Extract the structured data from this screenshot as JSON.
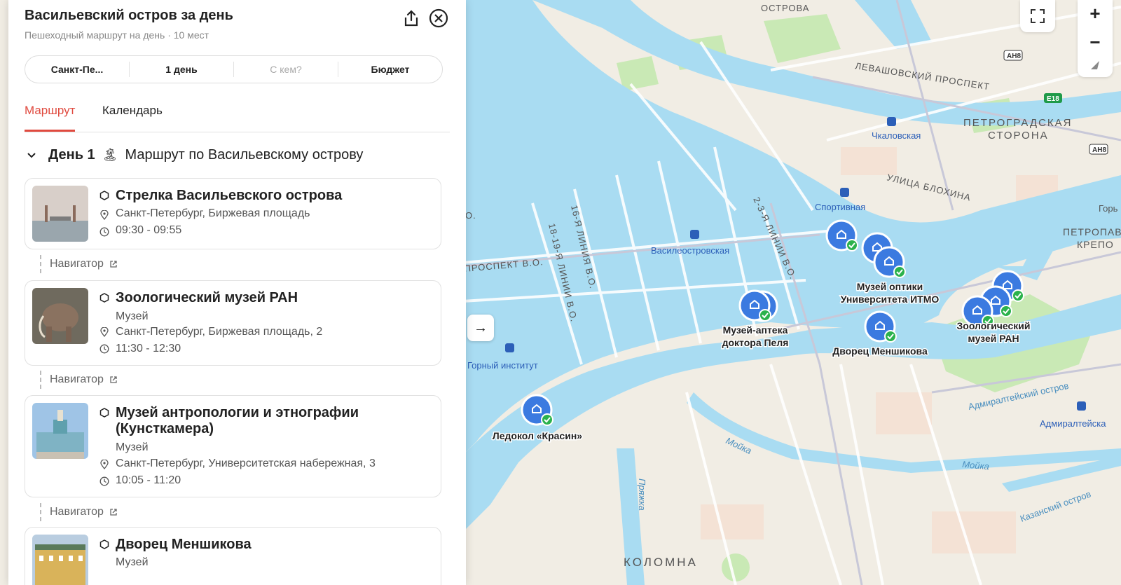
{
  "header": {
    "title": "Васильевский остров за день",
    "subtitle": "Пешеходный маршрут на день · 10 мест"
  },
  "filters": {
    "city": "Санкт-Пе...",
    "days": "1 день",
    "company": "С кем?",
    "budget": "Бюджет"
  },
  "tabs": {
    "route": "Маршрут",
    "calendar": "Календарь"
  },
  "day": {
    "label": "День 1",
    "emoji": "🏝",
    "title": "Маршрут по Васильевскому острову"
  },
  "places": [
    {
      "name": "Стрелка Васильевского острова",
      "category": "",
      "address": "Санкт-Петербург, Биржевая площадь",
      "time": "09:30 - 09:55"
    },
    {
      "name": "Зоологический музей РАН",
      "category": "Музей",
      "address": "Санкт-Петербург, Биржевая площадь, 2",
      "time": "11:30 - 12:30"
    },
    {
      "name_line1": "Музей антропологии и этнографии",
      "name_line2": "(Кунсткамера)",
      "category": "Музей",
      "address": "Санкт-Петербург, Университетская набережная, 3",
      "time": "10:05 - 11:20"
    },
    {
      "name": "Дворец Меншикова",
      "category": "Музей"
    }
  ],
  "navigator_label": "Навигатор",
  "map": {
    "districts": [
      "ОСТРОВА",
      "ПЕТРОГРАДСКАЯ",
      "СТОРОНА",
      "КОЛОМНА",
      "ПЕТРОПАВЛ",
      "КРЕПО"
    ],
    "streets": [
      "ЛЕВАШОВСКИЙ ПРОСПЕКТ",
      "УЛИЦА БЛОХИНА",
      "16-Я ЛИНИЯ В.О.",
      "18-19-Я ЛИНИИ В.О.",
      "2-3-Я ЛИНИИ В.О.",
      "ПРОСПЕКТ В.О.",
      "Адмиралтейский остров",
      "Казанский остров",
      "Мойка",
      "Мойка",
      "Пряжка",
      "О.",
      "Горь"
    ],
    "metro": [
      "Чкаловская",
      "Спортивная",
      "Василеостровская",
      "Горный институт",
      "Адмиралтейска"
    ],
    "road_badges": [
      "АН8",
      "E18",
      "АН8"
    ],
    "pins": [
      "Музей оптики",
      "Университета ИТМО",
      "Музей-аптека",
      "доктора Пеля",
      "Дворец Меншикова",
      "Зоологический",
      "музей РАН",
      "Ледокол «Красин»"
    ],
    "colors": {
      "water": "#a9dcf2",
      "land": "#f1ede4",
      "park": "#c9e9b5",
      "pin": "#3b7ae0",
      "check": "#2bb24c"
    }
  },
  "map_controls": {
    "zoom_in": "+",
    "zoom_out": "−",
    "next": "→"
  },
  "accent_color": "#e04a3f"
}
